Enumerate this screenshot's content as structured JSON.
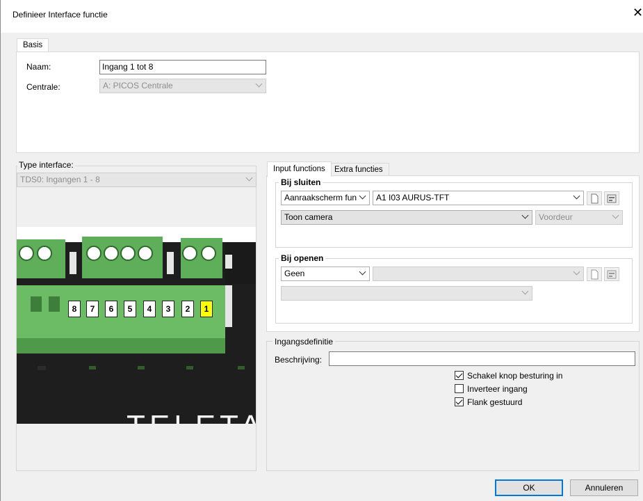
{
  "window": {
    "title": "Definieer Interface functie",
    "close_glyph": "✕"
  },
  "top_tabs": [
    {
      "label": "Basis"
    }
  ],
  "basis": {
    "naam_label": "Naam:",
    "naam_value": "Ingang 1 tot 8",
    "centrale_label": "Centrale:",
    "centrale_value": "A: PICOS Centrale"
  },
  "type_interface": {
    "label": "Type interface:",
    "value": "TDS0: Ingangen 1 - 8",
    "terminals": [
      "8",
      "7",
      "6",
      "5",
      "4",
      "3",
      "2",
      "1"
    ],
    "highlight_terminal": "1",
    "brand_text": "TELETA"
  },
  "right_tabs": [
    {
      "label": "Input functions",
      "active": true
    },
    {
      "label": "Extra functies",
      "active": false
    }
  ],
  "bij_sluiten": {
    "title": "Bij sluiten",
    "type_value": "Aanraakscherm fun",
    "device_value": "A1   I03 AURUS-TFT",
    "action_value": "Toon camera",
    "camera_value": "Voordeur"
  },
  "bij_openen": {
    "title": "Bij openen",
    "type_value": "Geen",
    "device_value": "",
    "action_value": ""
  },
  "ingangsdefinitie": {
    "title": "Ingangsdefinitie",
    "beschrijving_label": "Beschrijving:",
    "beschrijving_value": "",
    "checkboxes": [
      {
        "label": "Schakel knop besturing in",
        "checked": true
      },
      {
        "label": "Inverteer ingang",
        "checked": false
      },
      {
        "label": "Flank gestuurd",
        "checked": true
      }
    ]
  },
  "footer": {
    "ok_label": "OK",
    "cancel_label": "Annuleren"
  },
  "colors": {
    "accent": "#0078d7",
    "terminal_green": "#5fae5a",
    "highlight_yellow": "#ffff00"
  },
  "icons": [
    "close-icon",
    "chevron-down-icon",
    "new-document-icon",
    "properties-icon"
  ]
}
